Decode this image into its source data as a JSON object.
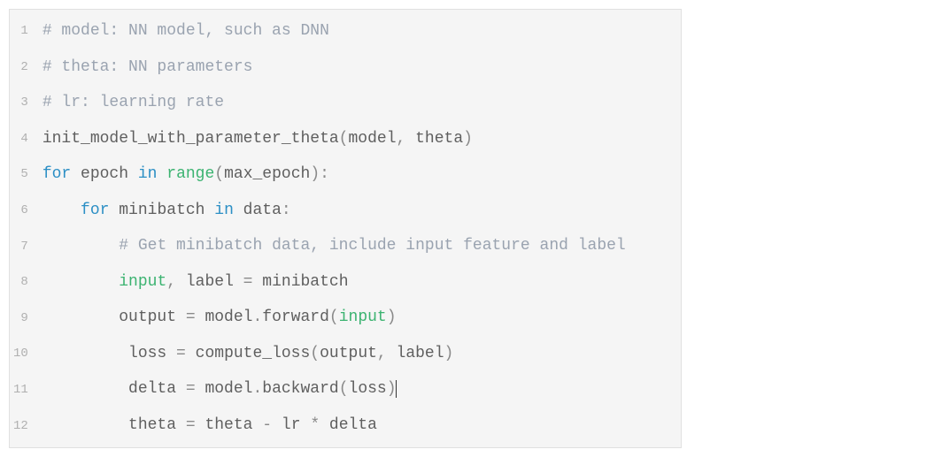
{
  "code": {
    "lines": [
      {
        "num": "1",
        "tokens": [
          {
            "cls": "tok-comment",
            "t": "# model: NN model, such as DNN"
          }
        ]
      },
      {
        "num": "2",
        "tokens": [
          {
            "cls": "tok-comment",
            "t": "# theta: NN parameters"
          }
        ]
      },
      {
        "num": "3",
        "tokens": [
          {
            "cls": "tok-comment",
            "t": "# lr: learning rate"
          }
        ]
      },
      {
        "num": "4",
        "tokens": [
          {
            "cls": "tok-name",
            "t": "init_model_with_parameter_theta"
          },
          {
            "cls": "tok-punct",
            "t": "("
          },
          {
            "cls": "tok-name",
            "t": "model"
          },
          {
            "cls": "tok-punct",
            "t": ", "
          },
          {
            "cls": "tok-name",
            "t": "theta"
          },
          {
            "cls": "tok-punct",
            "t": ")"
          }
        ]
      },
      {
        "num": "5",
        "tokens": [
          {
            "cls": "tok-keyword",
            "t": "for"
          },
          {
            "cls": "tok-name",
            "t": " epoch "
          },
          {
            "cls": "tok-keyword",
            "t": "in"
          },
          {
            "cls": "tok-name",
            "t": " "
          },
          {
            "cls": "tok-builtin",
            "t": "range"
          },
          {
            "cls": "tok-punct",
            "t": "("
          },
          {
            "cls": "tok-name",
            "t": "max_epoch"
          },
          {
            "cls": "tok-punct",
            "t": "):"
          }
        ]
      },
      {
        "num": "6",
        "tokens": [
          {
            "cls": "tok-name",
            "t": "    "
          },
          {
            "cls": "tok-keyword",
            "t": "for"
          },
          {
            "cls": "tok-name",
            "t": " minibatch "
          },
          {
            "cls": "tok-keyword",
            "t": "in"
          },
          {
            "cls": "tok-name",
            "t": " data"
          },
          {
            "cls": "tok-punct",
            "t": ":"
          }
        ]
      },
      {
        "num": "7",
        "tokens": [
          {
            "cls": "tok-name",
            "t": "        "
          },
          {
            "cls": "tok-comment",
            "t": "# Get minibatch data, include input feature and label"
          }
        ]
      },
      {
        "num": "8",
        "tokens": [
          {
            "cls": "tok-name",
            "t": "        "
          },
          {
            "cls": "tok-builtin",
            "t": "input"
          },
          {
            "cls": "tok-punct",
            "t": ", "
          },
          {
            "cls": "tok-name",
            "t": "label "
          },
          {
            "cls": "tok-op",
            "t": "="
          },
          {
            "cls": "tok-name",
            "t": " minibatch"
          }
        ]
      },
      {
        "num": "9",
        "tokens": [
          {
            "cls": "tok-name",
            "t": "        output "
          },
          {
            "cls": "tok-op",
            "t": "="
          },
          {
            "cls": "tok-name",
            "t": " model"
          },
          {
            "cls": "tok-punct",
            "t": "."
          },
          {
            "cls": "tok-name",
            "t": "forward"
          },
          {
            "cls": "tok-punct",
            "t": "("
          },
          {
            "cls": "tok-builtin",
            "t": "input"
          },
          {
            "cls": "tok-punct",
            "t": ")"
          }
        ]
      },
      {
        "num": "10",
        "tokens": [
          {
            "cls": "tok-name",
            "t": "         loss "
          },
          {
            "cls": "tok-op",
            "t": "="
          },
          {
            "cls": "tok-name",
            "t": " compute_loss"
          },
          {
            "cls": "tok-punct",
            "t": "("
          },
          {
            "cls": "tok-name",
            "t": "output"
          },
          {
            "cls": "tok-punct",
            "t": ", "
          },
          {
            "cls": "tok-name",
            "t": "label"
          },
          {
            "cls": "tok-punct",
            "t": ")"
          }
        ]
      },
      {
        "num": "11",
        "tokens": [
          {
            "cls": "tok-name",
            "t": "         delta "
          },
          {
            "cls": "tok-op",
            "t": "="
          },
          {
            "cls": "tok-name",
            "t": " model"
          },
          {
            "cls": "tok-punct",
            "t": "."
          },
          {
            "cls": "tok-name",
            "t": "backward"
          },
          {
            "cls": "tok-punct",
            "t": "("
          },
          {
            "cls": "tok-name",
            "t": "loss"
          },
          {
            "cls": "tok-punct",
            "t": ")"
          }
        ],
        "cursor": true
      },
      {
        "num": "12",
        "tokens": [
          {
            "cls": "tok-name",
            "t": "         theta "
          },
          {
            "cls": "tok-op",
            "t": "="
          },
          {
            "cls": "tok-name",
            "t": " theta "
          },
          {
            "cls": "tok-op",
            "t": "-"
          },
          {
            "cls": "tok-name",
            "t": " lr "
          },
          {
            "cls": "tok-op",
            "t": "*"
          },
          {
            "cls": "tok-name",
            "t": " delta"
          }
        ]
      }
    ]
  }
}
